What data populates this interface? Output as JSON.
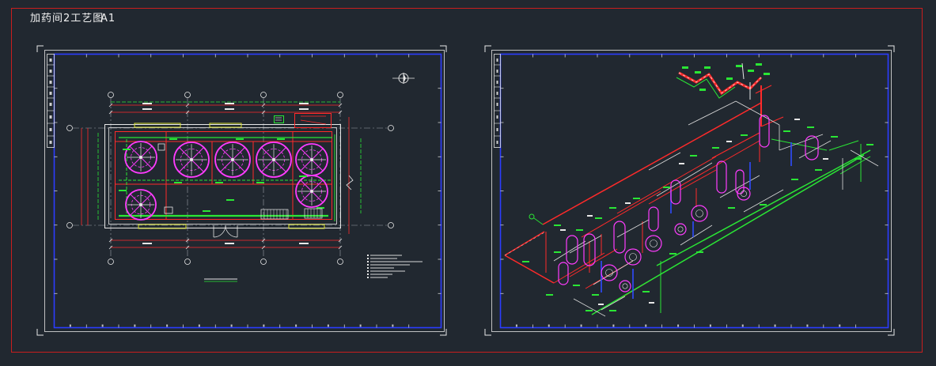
{
  "window": {
    "title": "加药间2工艺图",
    "sheet": "A1"
  },
  "colors": {
    "background": "#212830",
    "outer_frame": "#c81e1e",
    "sheet_frame": "#e8e8e8",
    "sheet_border": "#2b3cff",
    "pipe_red": "#ff2a2a",
    "pipe_green": "#2ae635",
    "tank_magenta": "#ff3cff",
    "pipe_blue": "#2f4bff",
    "window_yellow": "#d8e030"
  }
}
